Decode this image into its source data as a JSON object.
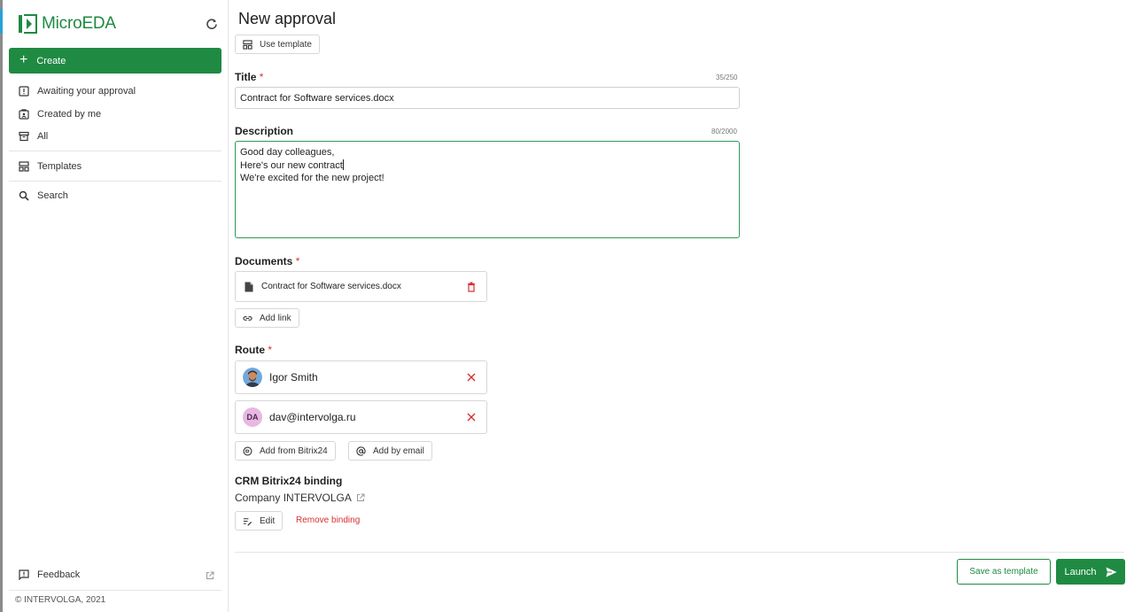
{
  "app": {
    "name": "MicroEDA",
    "brand_color": "#1f8a42",
    "refresh_icon": "refresh-icon"
  },
  "sidebar": {
    "create_label": "Create",
    "items": [
      {
        "label": "Awaiting your approval",
        "icon": "alert-doc-icon"
      },
      {
        "label": "Created by me",
        "icon": "doc-user-icon"
      },
      {
        "label": "All",
        "icon": "archive-icon"
      },
      {
        "label": "Templates",
        "icon": "template-icon"
      },
      {
        "label": "Search",
        "icon": "search-icon"
      }
    ],
    "feedback_label": "Feedback",
    "copyright": "© INTERVOLGA, 2021"
  },
  "form": {
    "page_title": "New approval",
    "use_template_label": "Use template",
    "title": {
      "label": "Title",
      "value": "Contract for Software services.docx",
      "counter": "35/250"
    },
    "description": {
      "label": "Description",
      "counter": "80/2000",
      "lines": [
        "Good day colleagues,",
        "Here's our new contract",
        "We're excited for the new project!"
      ]
    },
    "documents": {
      "label": "Documents",
      "file_name": "Contract for Software services.docx",
      "add_link_label": "Add link"
    },
    "route": {
      "label": "Route",
      "participants": [
        {
          "name": "Igor Smith",
          "avatar": "photo"
        },
        {
          "name": "dav@intervolga.ru",
          "initials": "DA"
        }
      ],
      "add_bitrix_label": "Add from Bitrix24",
      "add_email_label": "Add by email"
    },
    "crm": {
      "title": "CRM Bitrix24 binding",
      "company": "Company INTERVOLGA",
      "edit_label": "Edit",
      "remove_label": "Remove binding"
    },
    "actions": {
      "save_template_label": "Save as template",
      "launch_label": "Launch"
    },
    "required_mark": "*"
  }
}
